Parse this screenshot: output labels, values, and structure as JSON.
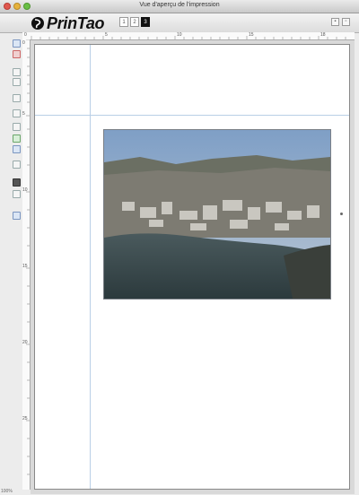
{
  "window": {
    "title": "Vue d'aperçu de l'impression"
  },
  "toolbar": {
    "logo_text": "PrinTao",
    "pages": [
      {
        "label": "1",
        "active": false
      },
      {
        "label": "2",
        "active": false
      },
      {
        "label": "3",
        "active": true
      }
    ]
  },
  "rulers": {
    "top_labels": [
      "0",
      "5",
      "10",
      "15",
      "18"
    ],
    "left_labels": [
      "0",
      "5",
      "10",
      "15",
      "20",
      "25"
    ]
  },
  "status": {
    "zoom": "100%"
  },
  "photo": {
    "description": "aerial view of coastal town"
  },
  "colors": {
    "guide": "#b9cfe6",
    "page": "#ffffff",
    "canvas": "#d9d9d9"
  }
}
